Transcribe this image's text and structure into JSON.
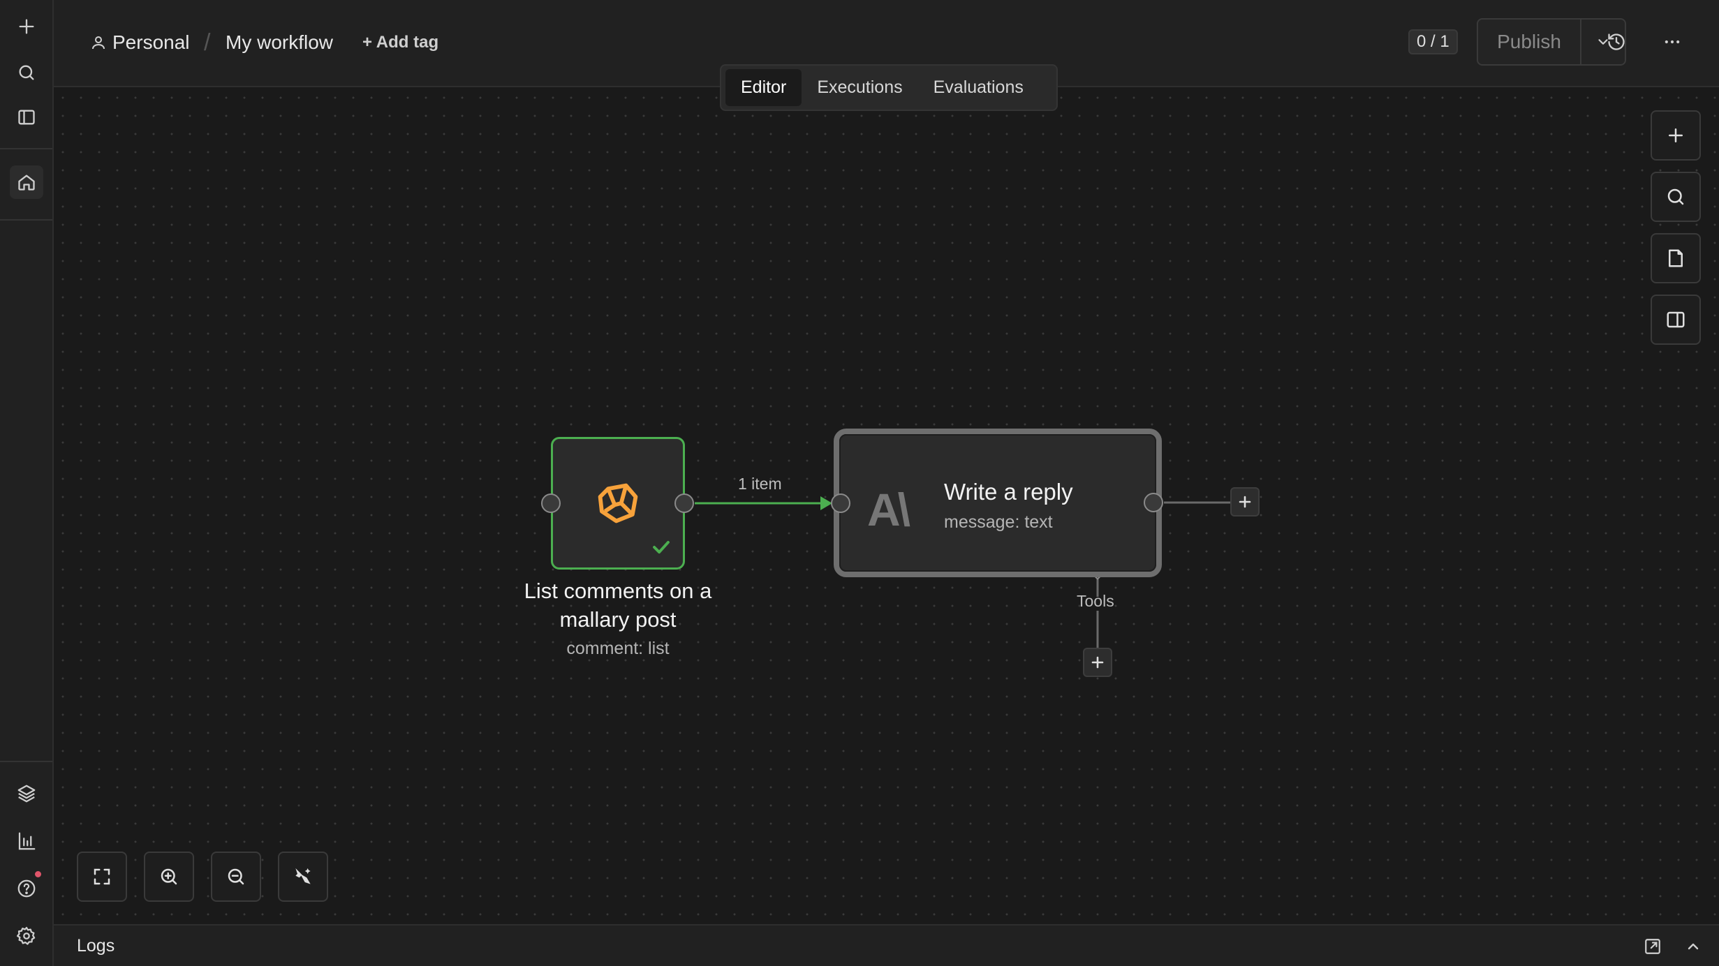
{
  "breadcrumb": {
    "project": "Personal",
    "separator": "/",
    "workflow": "My workflow",
    "add_tag": "+ Add tag"
  },
  "header": {
    "counter": "0 / 1",
    "publish_label": "Publish"
  },
  "tabs": [
    {
      "label": "Editor",
      "active": true
    },
    {
      "label": "Executions",
      "active": false
    },
    {
      "label": "Evaluations",
      "active": false
    }
  ],
  "nodes": {
    "list_comments": {
      "title": "List comments on a mallary post",
      "subtitle": "comment: list",
      "status": "success",
      "border_color": "#4caf50",
      "icon": "mallary-logo-icon",
      "icon_color": "#f7a23b"
    },
    "write_reply": {
      "title": "Write a reply",
      "subtitle": "message: text",
      "logo_text": "A\\",
      "icon": "anthropic-logo-icon"
    }
  },
  "connection": {
    "label": "1 item",
    "color": "#4caf50"
  },
  "tools_connector": {
    "label": "Tools"
  },
  "logs": {
    "label": "Logs"
  },
  "rail_icons": [
    "plus-icon",
    "search-icon",
    "sidebar-icon",
    "home-icon",
    "templates-icon",
    "insights-icon",
    "help-icon",
    "settings-icon"
  ],
  "canvas_tools": [
    "add-node-icon",
    "search-icon",
    "sticky-note-icon",
    "toggle-panel-icon"
  ],
  "zoom_controls": [
    "fit-view-icon",
    "zoom-in-icon",
    "zoom-out-icon",
    "tidy-up-icon"
  ]
}
